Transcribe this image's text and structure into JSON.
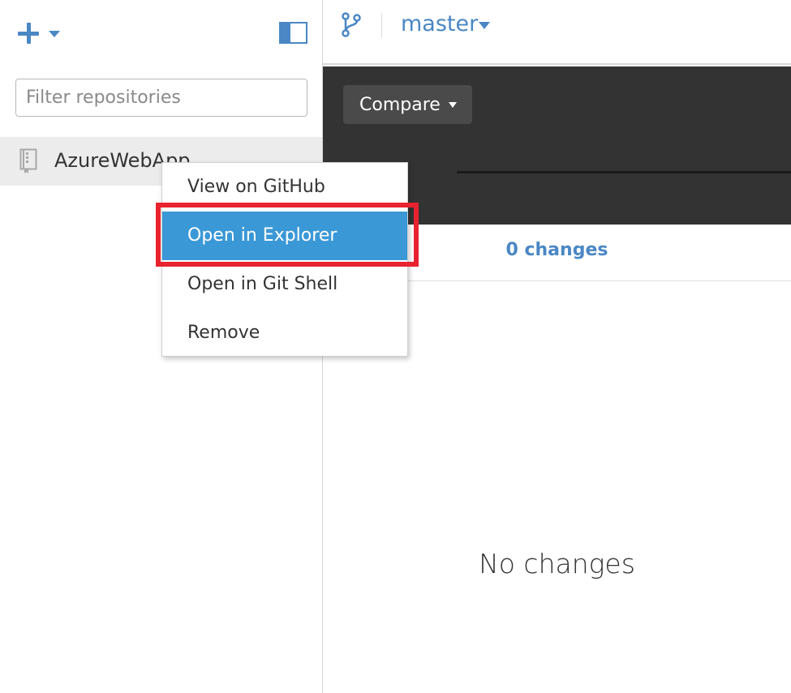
{
  "sidebar": {
    "filter_placeholder": "Filter repositories",
    "repositories": [
      {
        "name": "AzureWebApp"
      }
    ]
  },
  "header": {
    "branch": "master"
  },
  "compare": {
    "label": "Compare"
  },
  "changes": {
    "count_label": "0 changes",
    "empty_message": "No changes"
  },
  "context_menu": {
    "items": [
      {
        "label": "View on GitHub"
      },
      {
        "label": "Open in Explorer",
        "selected": true
      },
      {
        "label": "Open in Git Shell"
      },
      {
        "label": "Remove"
      }
    ]
  },
  "colors": {
    "accent": "#4a87c4",
    "selection": "#3b98d6",
    "highlight": "#e8232f",
    "dark_panel": "#333333"
  },
  "icons": {
    "add": "plus-icon",
    "add_dropdown": "chevron-down-icon",
    "panel_toggle": "sidebar-toggle-icon",
    "repo": "repository-icon",
    "branch": "git-branch-icon",
    "branch_dropdown": "chevron-down-icon"
  }
}
